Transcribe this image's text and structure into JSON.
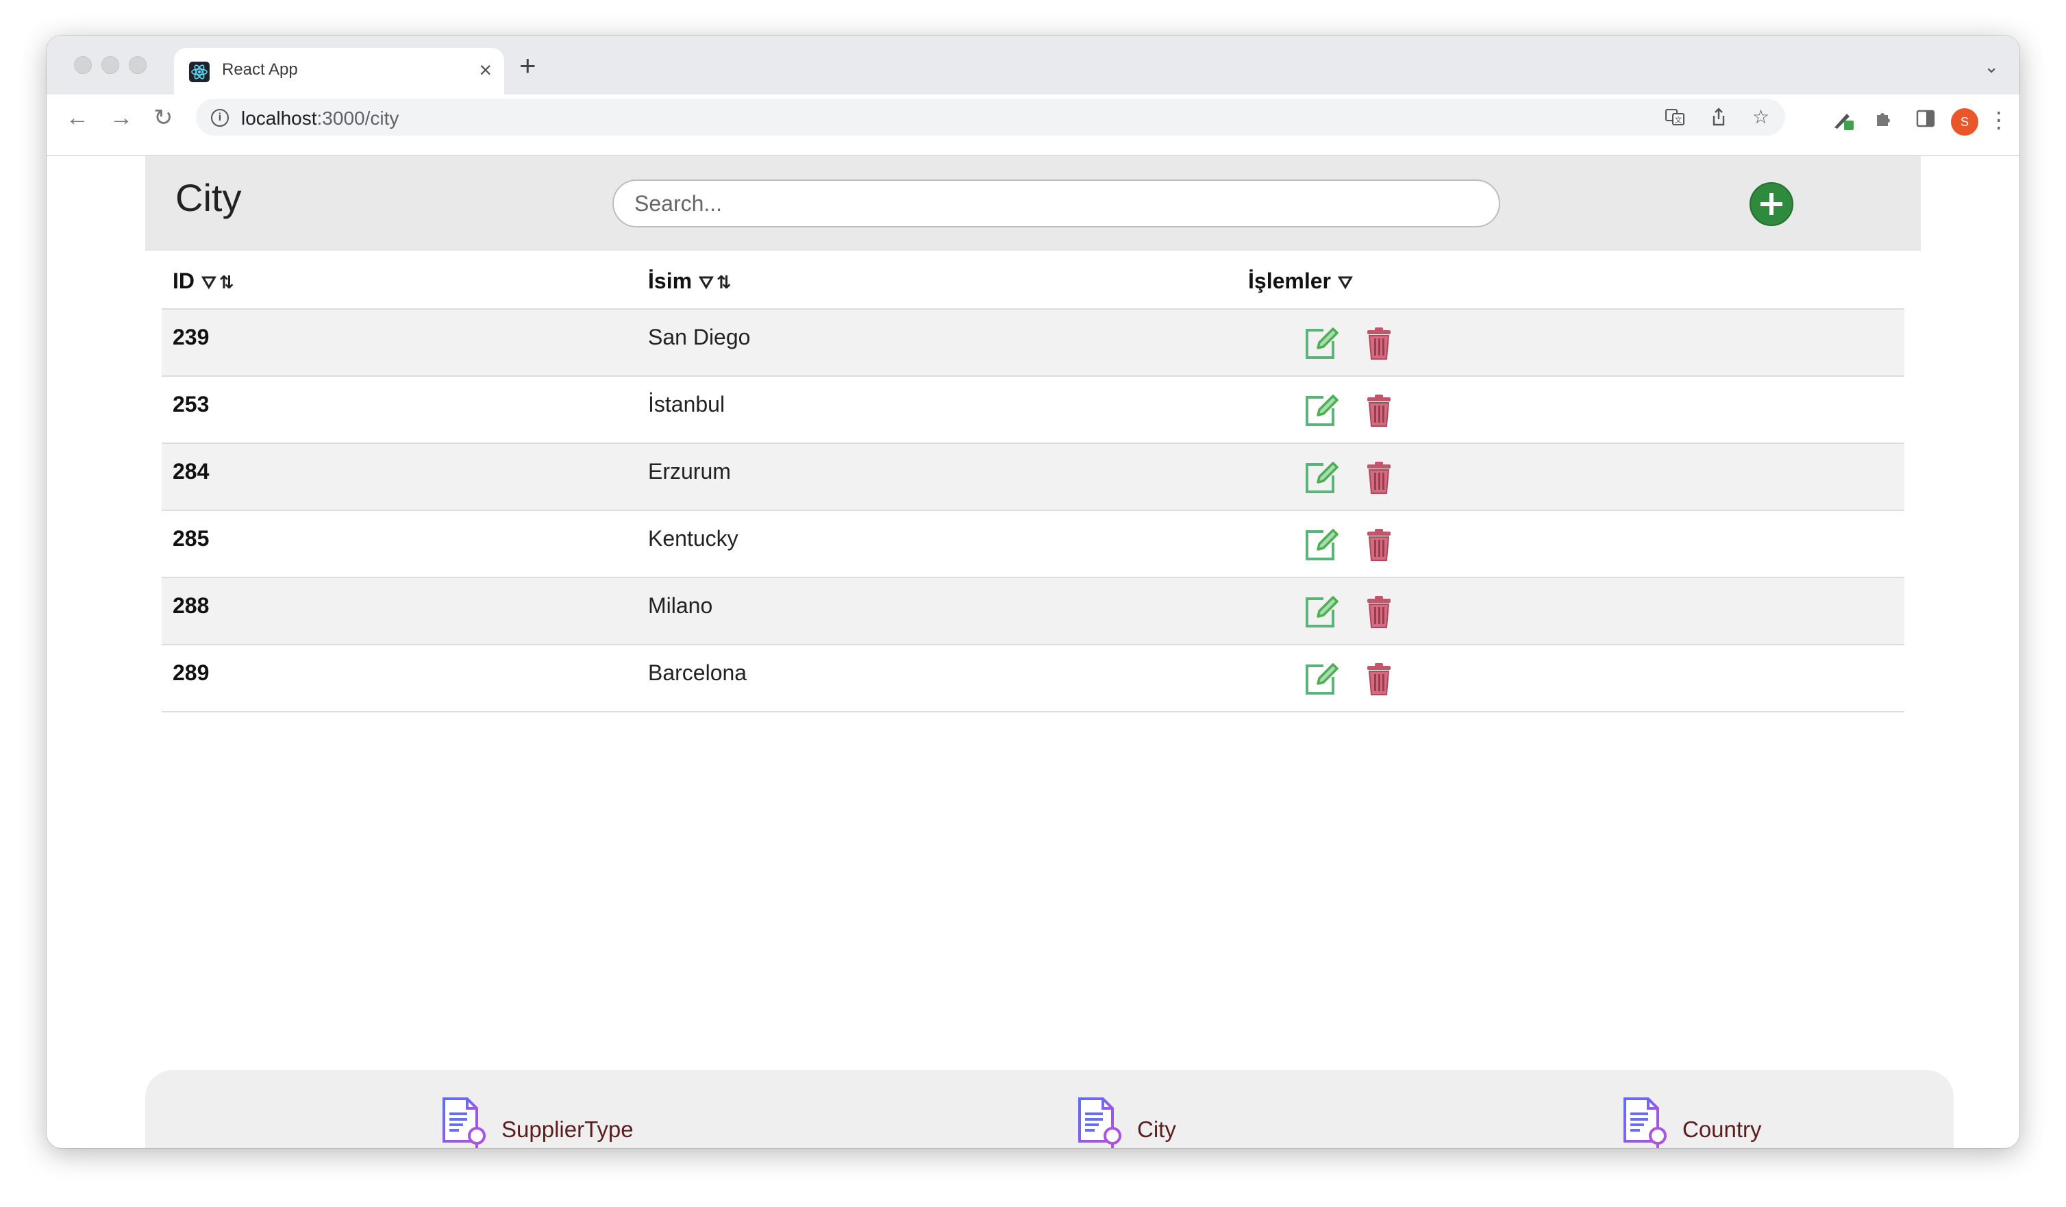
{
  "browser": {
    "tab_title": "React App",
    "tab_close": "×",
    "new_tab": "+",
    "tab_menu": "⌄",
    "url_host": "localhost",
    "url_path": ":3000/city",
    "avatar_initial": "S",
    "icons": [
      "back-arrow",
      "forward-arrow",
      "reload",
      "site-info",
      "translate",
      "share",
      "bookmark-star",
      "extension-pen",
      "puzzle-extensions",
      "side-panel",
      "profile-avatar",
      "more-menu"
    ]
  },
  "header": {
    "title": "City",
    "search_placeholder": "Search...",
    "add_icon": "plus-circle",
    "add_color": "#2e8b3e"
  },
  "table": {
    "columns": [
      {
        "label": "ID",
        "filter": true,
        "sort": true
      },
      {
        "label": "İsim",
        "filter": true,
        "sort": true
      },
      {
        "label": "İşlemler",
        "filter": true,
        "sort": false
      }
    ],
    "filter_symbol": "⛛",
    "sort_symbol": "⇅",
    "rows": [
      {
        "id": "239",
        "name": "San Diego"
      },
      {
        "id": "253",
        "name": "İstanbul"
      },
      {
        "id": "284",
        "name": "Erzurum"
      },
      {
        "id": "285",
        "name": "Kentucky"
      },
      {
        "id": "288",
        "name": "Milano"
      },
      {
        "id": "289",
        "name": "Barcelona"
      }
    ],
    "edit_color": "#4caf50",
    "delete_color": "#c0556b"
  },
  "bottom_nav": {
    "items": [
      {
        "label": "SupplierType",
        "icon": "document-search-icon"
      },
      {
        "label": "City",
        "icon": "document-search-icon"
      },
      {
        "label": "Country",
        "icon": "document-search-icon"
      }
    ]
  }
}
